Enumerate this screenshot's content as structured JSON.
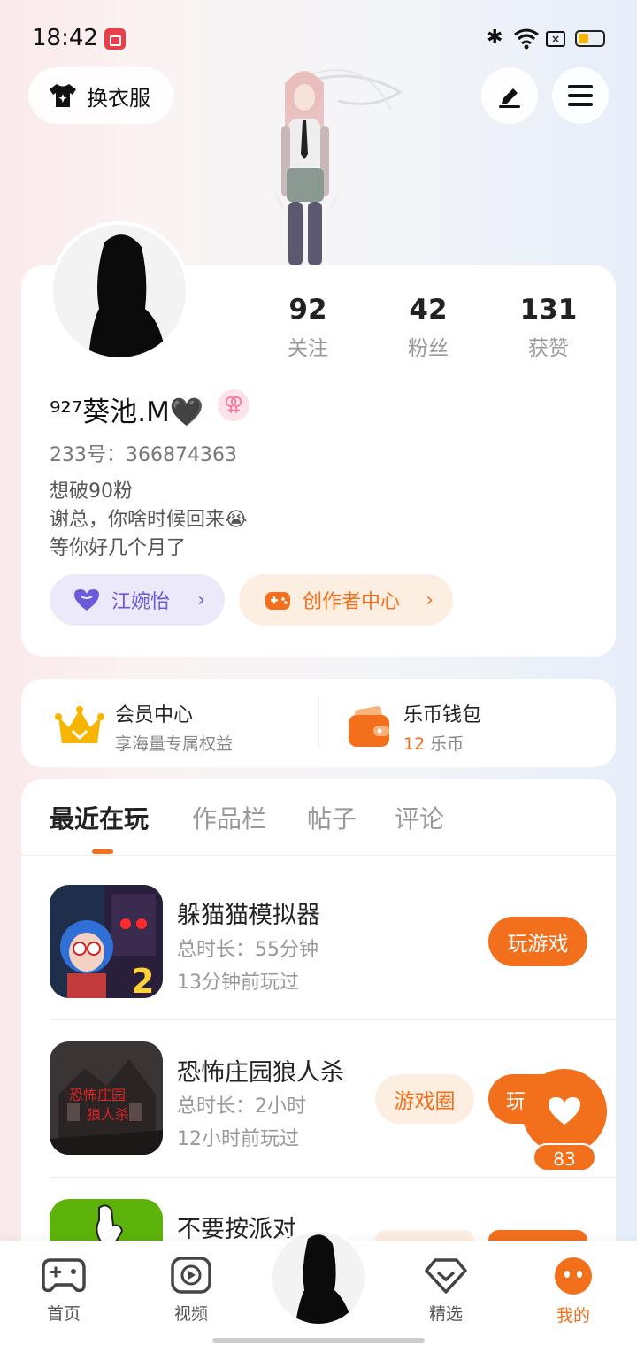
{
  "status_bar": {
    "time": "18:42"
  },
  "header": {
    "dress_label": "换衣服"
  },
  "profile": {
    "stats": [
      {
        "value": "92",
        "label": "关注"
      },
      {
        "value": "42",
        "label": "粉丝"
      },
      {
        "value": "131",
        "label": "获赞"
      }
    ],
    "name": "⁹²⁷葵池.M🖤",
    "gender_symbol": "⚢",
    "uid": "233号：366874363",
    "bio_lines": [
      "想破90粉",
      "谢总，你啥时候回来😭",
      "等你好几个月了"
    ],
    "fan_club_label": "江婉怡",
    "creator_label": "创作者中心"
  },
  "membership": {
    "member_title": "会员中心",
    "member_sub": "享海量专属权益",
    "wallet_title": "乐币钱包",
    "wallet_amount": "12",
    "wallet_unit": "乐币"
  },
  "tabs": [
    {
      "label": "最近在玩",
      "active": true
    },
    {
      "label": "作品栏",
      "active": false
    },
    {
      "label": "帖子",
      "active": false
    },
    {
      "label": "评论",
      "active": false
    }
  ],
  "games": [
    {
      "title": "躲猫猫模拟器",
      "duration": "总时长：55分钟",
      "last_played": "13分钟前玩过",
      "play_label": "玩游戏",
      "circle_label": ""
    },
    {
      "title": "恐怖庄园狼人杀",
      "duration": "总时长：2小时",
      "last_played": "12小时前玩过",
      "play_label": "玩",
      "circle_label": "游戏圈"
    },
    {
      "title": "不要按派对",
      "duration": "",
      "last_played": "",
      "play_label": "",
      "circle_label": ""
    }
  ],
  "float_like": {
    "count": "83"
  },
  "bottom_nav": [
    {
      "label": "首页",
      "icon": "gamepad-icon"
    },
    {
      "label": "视频",
      "icon": "play-icon"
    },
    {
      "label": "精选",
      "icon": "heart-diamond-icon"
    },
    {
      "label": "我的",
      "icon": "face-icon"
    }
  ],
  "colors": {
    "accent": "#f26f1b",
    "fan_purple": "#6b5bd8",
    "creator_bg": "#fdeee2"
  }
}
